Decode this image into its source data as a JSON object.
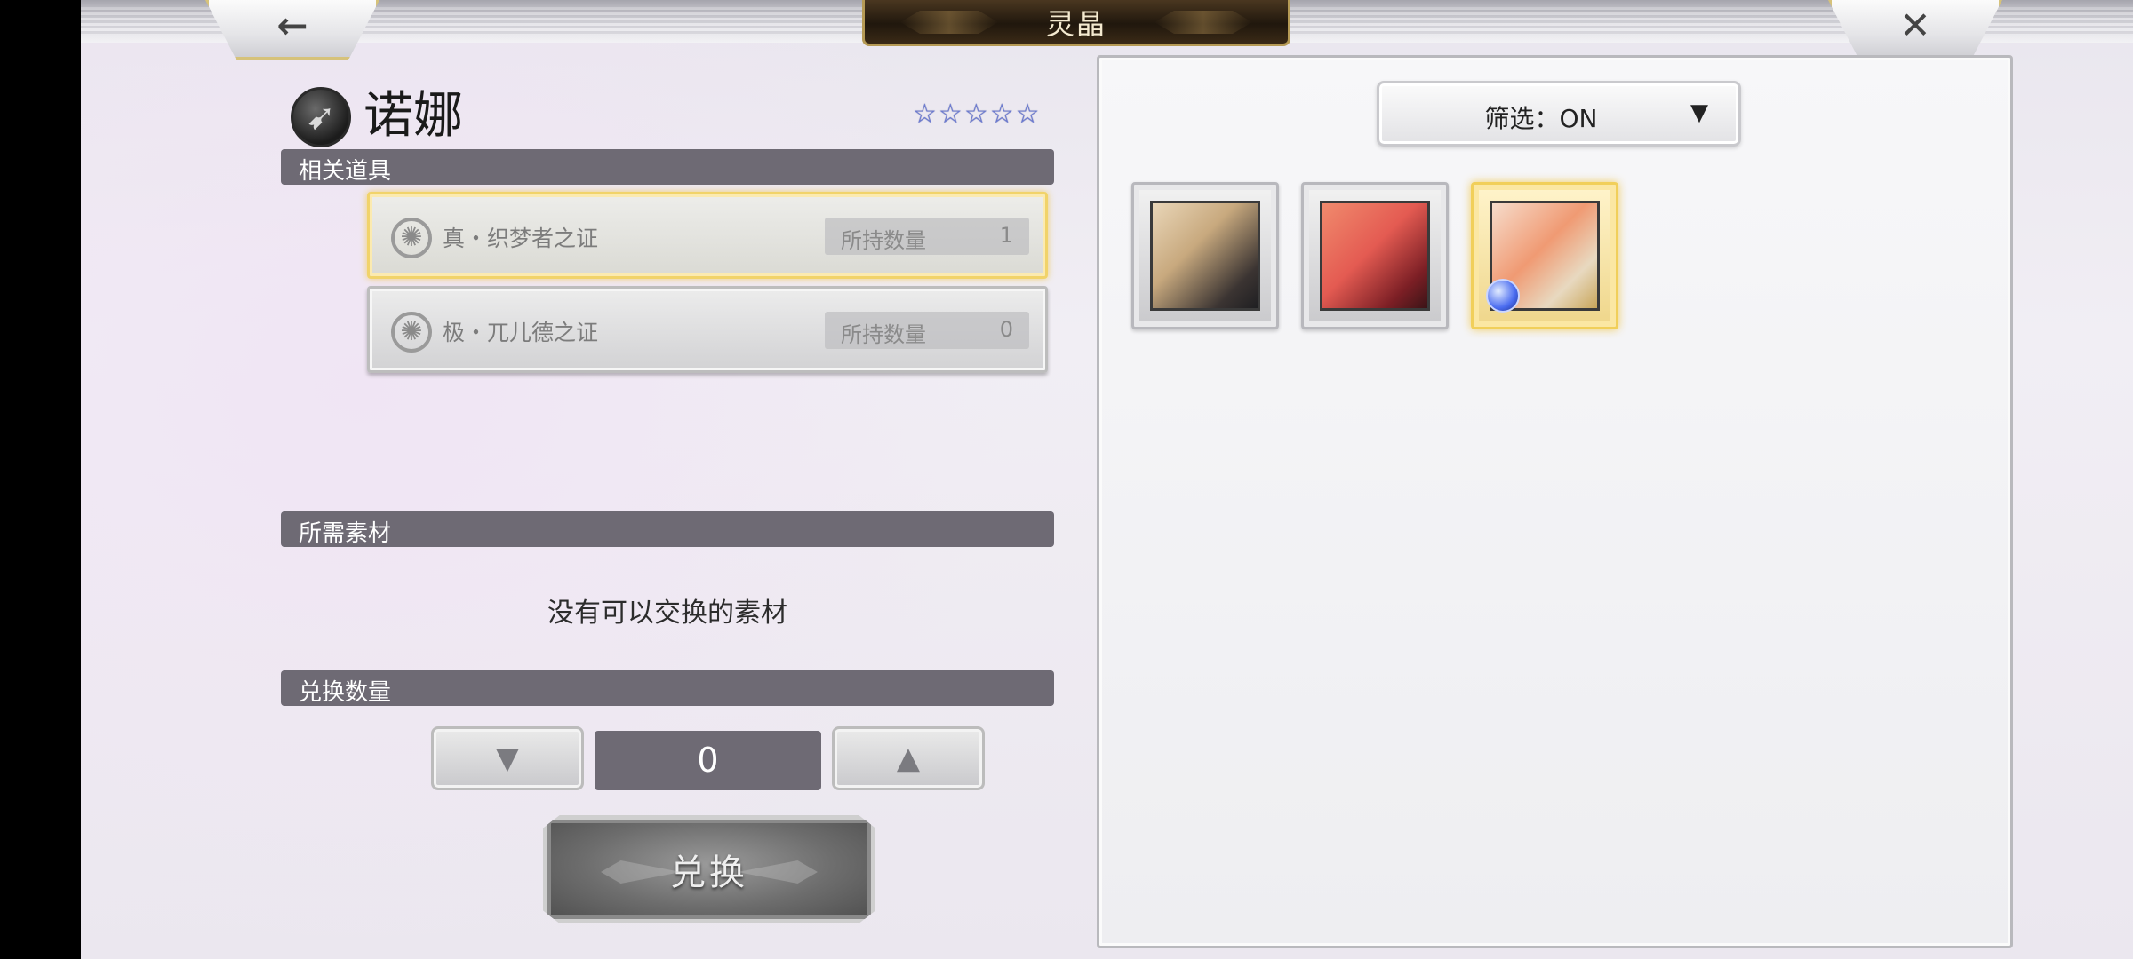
{
  "header": {
    "title": "灵晶",
    "back_icon": "←",
    "close_icon": "✕"
  },
  "character": {
    "name": "诺娜",
    "class_icon": "bow",
    "class_glyph": "➹",
    "rarity_stars": 5,
    "stars": [
      "☆",
      "☆",
      "☆",
      "☆",
      "☆"
    ]
  },
  "related_items": {
    "section_label": "相关道具",
    "items": [
      {
        "name": "真・织梦者之证",
        "qty_label": "所持数量",
        "qty": "1",
        "selected": true,
        "icon": "gear-emblem"
      },
      {
        "name": "极・兀儿德之证",
        "qty_label": "所持数量",
        "qty": "0",
        "selected": false,
        "icon": "gear-emblem"
      }
    ],
    "gear_glyph": "✺"
  },
  "materials": {
    "section_label": "所需素材",
    "empty_message": "没有可以交换的素材"
  },
  "exchange_qty": {
    "section_label": "兑换数量",
    "value": "0",
    "down_icon": "▼",
    "up_icon": "▲"
  },
  "exchange_button": {
    "label": "兑换"
  },
  "filter": {
    "label": "筛选：ON",
    "caret": "▼"
  },
  "portraits": [
    {
      "id": "char-1",
      "selected": false
    },
    {
      "id": "char-2",
      "selected": false
    },
    {
      "id": "char-3",
      "selected": true,
      "has_gem": true
    }
  ],
  "colors": {
    "section_bar": "#6e6a74",
    "selection_gold": "#f1d36a",
    "star_blue": "#6b7bd6"
  }
}
